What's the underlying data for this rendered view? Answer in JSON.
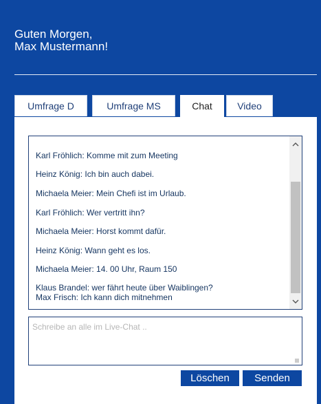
{
  "header": {
    "greeting_line1": "Guten Morgen,",
    "greeting_line2": "Max Mustermann!"
  },
  "tabs": [
    {
      "label": "Umfrage D",
      "active": false
    },
    {
      "label": "Umfrage MS",
      "active": false
    },
    {
      "label": "Chat",
      "active": true
    },
    {
      "label": "Video",
      "active": false
    }
  ],
  "chat": {
    "messages": [
      {
        "text": "Karl Fröhlich: Komme mit zum Meeting"
      },
      {
        "text": "Heinz König: Ich bin auch dabei."
      },
      {
        "text": "Michaela Meier: Mein Chefi ist im Urlaub."
      },
      {
        "text": "Karl Fröhlich: Wer vertritt ihn?"
      },
      {
        "text": "Michaela Meier: Horst kommt dafür."
      },
      {
        "text": "Heinz König: Wann geht es los."
      },
      {
        "text": "Michaela Meier: 14. 00 Uhr, Raum 150"
      },
      {
        "text": "Klaus Brandel: wer fährt heute über Waiblingen?"
      },
      {
        "text": "Max Frisch: Ich kann dich mitnehmen"
      }
    ],
    "scroll_up_icon": "chevron-up-icon",
    "scroll_down_icon": "chevron-down-icon"
  },
  "input": {
    "placeholder": "Schreibe an alle im Live-Chat .."
  },
  "buttons": {
    "delete_label": "Löschen",
    "send_label": "Senden"
  },
  "colors": {
    "brand_blue": "#0d47a1",
    "text_blue": "#13335f",
    "panel_white": "#ffffff"
  }
}
